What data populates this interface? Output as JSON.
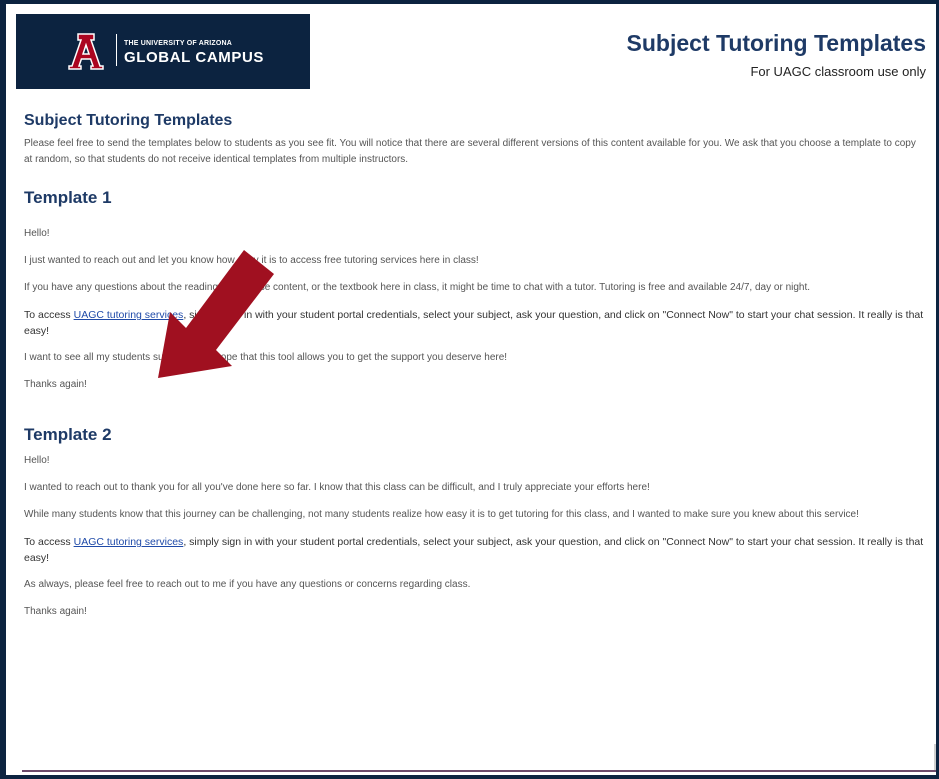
{
  "header": {
    "logo_small": "THE UNIVERSITY OF ARIZONA",
    "logo_big": "GLOBAL CAMPUS",
    "title": "Subject Tutoring Templates",
    "subtitle": "For UAGC classroom use only"
  },
  "intro": {
    "heading": "Subject Tutoring Templates",
    "text": "Please feel free to send the templates below to students as you see fit. You will notice that there are several different versions of this content available for you. We ask that you choose a template to copy at random, so that students do not receive identical templates from multiple instructors."
  },
  "template1": {
    "heading": "Template 1",
    "greeting": "Hello!",
    "p1": "I just wanted to reach out and let you know how easy it is to access free tutoring services here in class!",
    "p2": "If you have any questions about the reading, the course content, or the textbook here in class, it might be time to chat with a tutor. Tutoring is free and available 24/7, day or night.",
    "p3_before": "To access ",
    "p3_link": "UAGC tutoring services",
    "p3_after": ", simply sign in with your student portal credentials, select your subject, ask your question, and click on \"Connect Now\" to start your chat session. It really is that easy!",
    "p4": "I want to see all my students succeed, and hope that this tool allows you to get the support you deserve here!",
    "closing": "Thanks again!"
  },
  "template2": {
    "heading": "Template 2",
    "greeting": "Hello!",
    "p1": "I wanted to reach out to thank you for all you've done here so far. I know that this class can be difficult, and I truly appreciate your efforts here!",
    "p2": "While many students know that this journey can be challenging, not many students realize how easy it is to get tutoring for this class, and I wanted to make sure you knew about this service!",
    "p3_before": "To access ",
    "p3_link": "UAGC tutoring services",
    "p3_after": ", simply sign in with your student portal credentials, select your subject, ask your question, and click on \"Connect Now\" to start your chat session. It really is that easy!",
    "p4": "As always, please feel free to reach out to me if you have any questions or concerns regarding class.",
    "closing": "Thanks again!"
  },
  "colors": {
    "brand_navy": "#0c2340",
    "heading_blue": "#1e3a66",
    "link_blue": "#1f4aa8",
    "arrow_red": "#a01020",
    "logo_red": "#ab0520"
  },
  "icons": {
    "logo_mark": "block-a-logo",
    "pointer": "arrow-pointer-icon"
  }
}
